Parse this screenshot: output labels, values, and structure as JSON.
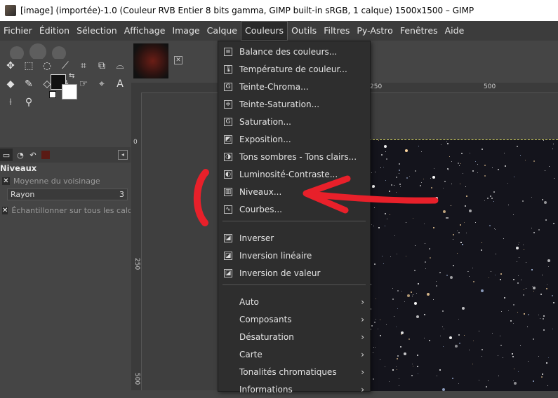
{
  "window": {
    "title": "[image] (importée)-1.0 (Couleur RVB Entier 8 bits gamma, GIMP built-in sRGB, 1 calque) 1500x1500 – GIMP"
  },
  "menubar": [
    {
      "label": "Fichier",
      "name": "menu-fichier"
    },
    {
      "label": "Édition",
      "name": "menu-edition"
    },
    {
      "label": "Sélection",
      "name": "menu-selection"
    },
    {
      "label": "Affichage",
      "name": "menu-affichage"
    },
    {
      "label": "Image",
      "name": "menu-image"
    },
    {
      "label": "Calque",
      "name": "menu-calque"
    },
    {
      "label": "Couleurs",
      "name": "menu-couleurs",
      "active": true
    },
    {
      "label": "Outils",
      "name": "menu-outils"
    },
    {
      "label": "Filtres",
      "name": "menu-filtres"
    },
    {
      "label": "Py-Astro",
      "name": "menu-py-astro"
    },
    {
      "label": "Fenêtres",
      "name": "menu-fenetres"
    },
    {
      "label": "Aide",
      "name": "menu-aide"
    }
  ],
  "tool_options": {
    "title": "Niveaux",
    "sample_merged_label": "Moyenne du voisinage",
    "radius_label": "Rayon",
    "radius_value": "3",
    "sample_all_label": "Échantillonner sur tous les calques"
  },
  "rulers": {
    "top_ticks": [
      "250",
      "500"
    ],
    "left_ticks": [
      "0",
      "250",
      "500"
    ]
  },
  "couleurs_menu": {
    "items": [
      {
        "label": "Balance des couleurs...",
        "icon": "color-balance-icon",
        "glyph": "≡"
      },
      {
        "label": "Température de couleur...",
        "icon": "thermometer-icon",
        "glyph": "🌡"
      },
      {
        "label": "Teinte-Chroma...",
        "icon": "hue-chroma-icon",
        "glyph": "G"
      },
      {
        "label": "Teinte-Saturation...",
        "icon": "hue-saturation-icon",
        "glyph": "≑"
      },
      {
        "label": "Saturation...",
        "icon": "saturation-icon",
        "glyph": "G"
      },
      {
        "label": "Exposition...",
        "icon": "exposure-icon",
        "glyph": "◩"
      },
      {
        "label": "Tons sombres - Tons clairs...",
        "icon": "shadows-highlights-icon",
        "glyph": "◑"
      },
      {
        "label": "Luminosité-Contraste...",
        "icon": "brightness-contrast-icon",
        "glyph": "◐"
      },
      {
        "label": "Niveaux...",
        "icon": "levels-icon",
        "glyph": "▥"
      },
      {
        "label": "Courbes...",
        "icon": "curves-icon",
        "glyph": "∿"
      },
      {
        "label": "Inverser",
        "icon": "invert-icon",
        "glyph": "◪"
      },
      {
        "label": "Inversion linéaire",
        "icon": "linear-invert-icon",
        "glyph": "◪"
      },
      {
        "label": "Inversion de valeur",
        "icon": "value-invert-icon",
        "glyph": "◪"
      },
      {
        "label": "Auto",
        "submenu": true
      },
      {
        "label": "Composants",
        "submenu": true
      },
      {
        "label": "Désaturation",
        "submenu": true
      },
      {
        "label": "Carte",
        "submenu": true
      },
      {
        "label": "Tonalités chromatiques",
        "submenu": true
      },
      {
        "label": "Informations",
        "submenu": true
      }
    ]
  },
  "colors": {
    "annotation": "#e8202a",
    "foreground": "#111111",
    "background": "#ffffff"
  }
}
